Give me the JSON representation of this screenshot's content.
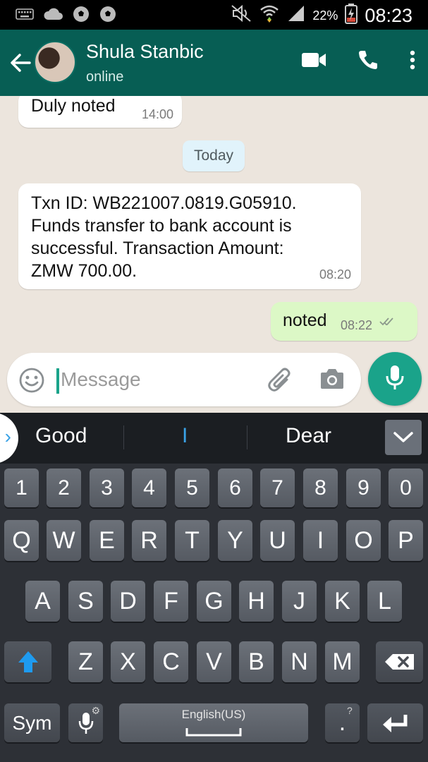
{
  "status_bar": {
    "battery_percent": "22%",
    "time": "08:23",
    "left_icons": [
      "keyboard-icon",
      "cloud-icon",
      "soccer-ball-icon",
      "soccer-ball-icon"
    ],
    "right_icons": [
      "mute-icon",
      "wifi-icon",
      "signal-icon",
      "battery-charging-icon"
    ]
  },
  "chat_header": {
    "name": "Shula Stanbic",
    "status": "online",
    "accent_color": "#075e54"
  },
  "messages": {
    "previous": {
      "text": "Duly noted",
      "time": "14:00"
    },
    "date_divider": "Today",
    "txn": {
      "lines": [
        "Txn ID: WB221007.0819.G05910.",
        "Funds transfer to bank account is",
        "successful. Transaction Amount:",
        "ZMW 700.00."
      ],
      "time": "08:20"
    },
    "outgoing": {
      "text": "noted",
      "time": "08:22",
      "status": "delivered-double-check"
    }
  },
  "composer": {
    "placeholder": "Message"
  },
  "suggestions": [
    "Good",
    "I",
    "Dear"
  ],
  "keyboard": {
    "number_row": [
      "1",
      "2",
      "3",
      "4",
      "5",
      "6",
      "7",
      "8",
      "9",
      "0"
    ],
    "row1": [
      "Q",
      "W",
      "E",
      "R",
      "T",
      "Y",
      "U",
      "I",
      "O",
      "P"
    ],
    "row2": [
      "A",
      "S",
      "D",
      "F",
      "G",
      "H",
      "J",
      "K",
      "L"
    ],
    "row3": [
      "Z",
      "X",
      "C",
      "V",
      "B",
      "N",
      "M"
    ],
    "sym": "Sym",
    "space_label": "English(US)",
    "period": ".",
    "mic_hint": "⚙",
    "period_hint": "?"
  }
}
